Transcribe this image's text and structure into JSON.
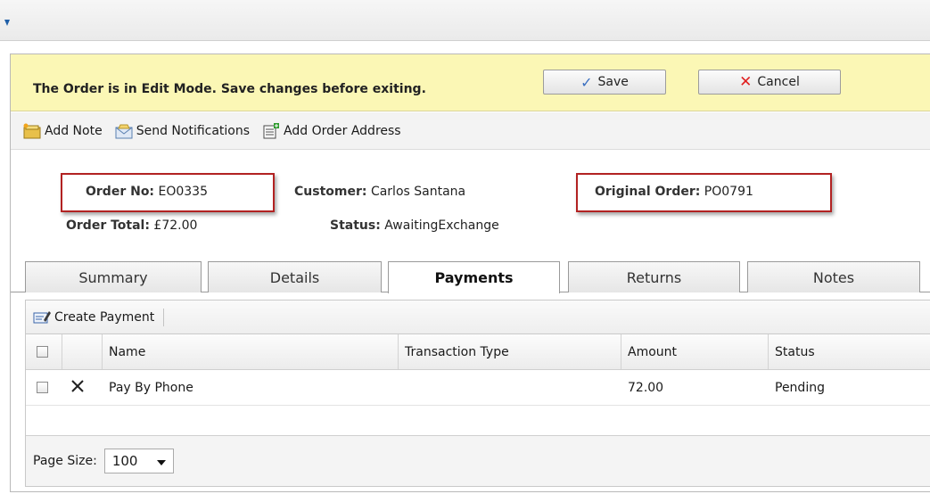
{
  "edit_bar": {
    "message": "The Order is in Edit Mode. Save changes before exiting.",
    "save_label": "Save",
    "cancel_label": "Cancel"
  },
  "actions": {
    "add_note": "Add Note",
    "send_notifications": "Send Notifications",
    "add_order_address": "Add Order Address"
  },
  "order": {
    "order_no_label": "Order No:",
    "order_no": "EO0335",
    "order_total_label": "Order Total:",
    "order_total": "£72.00",
    "customer_label": "Customer:",
    "customer": "Carlos Santana",
    "status_label": "Status:",
    "status": "AwaitingExchange",
    "original_order_label": "Original Order:",
    "original_order": "PO0791"
  },
  "tabs": [
    {
      "label": "Summary",
      "active": false
    },
    {
      "label": "Details",
      "active": false
    },
    {
      "label": "Payments",
      "active": true
    },
    {
      "label": "Returns",
      "active": false
    },
    {
      "label": "Notes",
      "active": false
    }
  ],
  "payments": {
    "create_label": "Create Payment",
    "columns": [
      "Name",
      "Transaction Type",
      "Amount",
      "Status"
    ],
    "rows": [
      {
        "name": "Pay By Phone",
        "transaction_type": "",
        "amount": "72.00",
        "status": "Pending"
      }
    ],
    "page_size_label": "Page Size:",
    "page_size": "100"
  },
  "colors": {
    "edit_bar_bg": "#fbf7b5",
    "highlight_border": "#b22222",
    "save_check": "#3a6fc0",
    "cancel_x": "#e02020"
  }
}
